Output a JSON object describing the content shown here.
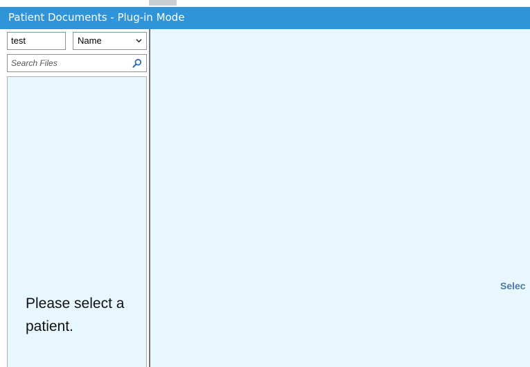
{
  "window": {
    "title": "Patient Documents - Plug-in Mode",
    "accent_color": "#2f95d8",
    "panel_background": "#e8f6fd"
  },
  "sidebar": {
    "filter_value": "test",
    "sort": {
      "selected": "Name"
    },
    "search": {
      "placeholder": "Search Files",
      "value": ""
    },
    "patient_list": {
      "empty_message": "Please select a patient."
    }
  },
  "main": {
    "empty_message": "Selec"
  },
  "icons": {
    "search": "search-icon",
    "dropdown": "chevron-down-icon"
  }
}
